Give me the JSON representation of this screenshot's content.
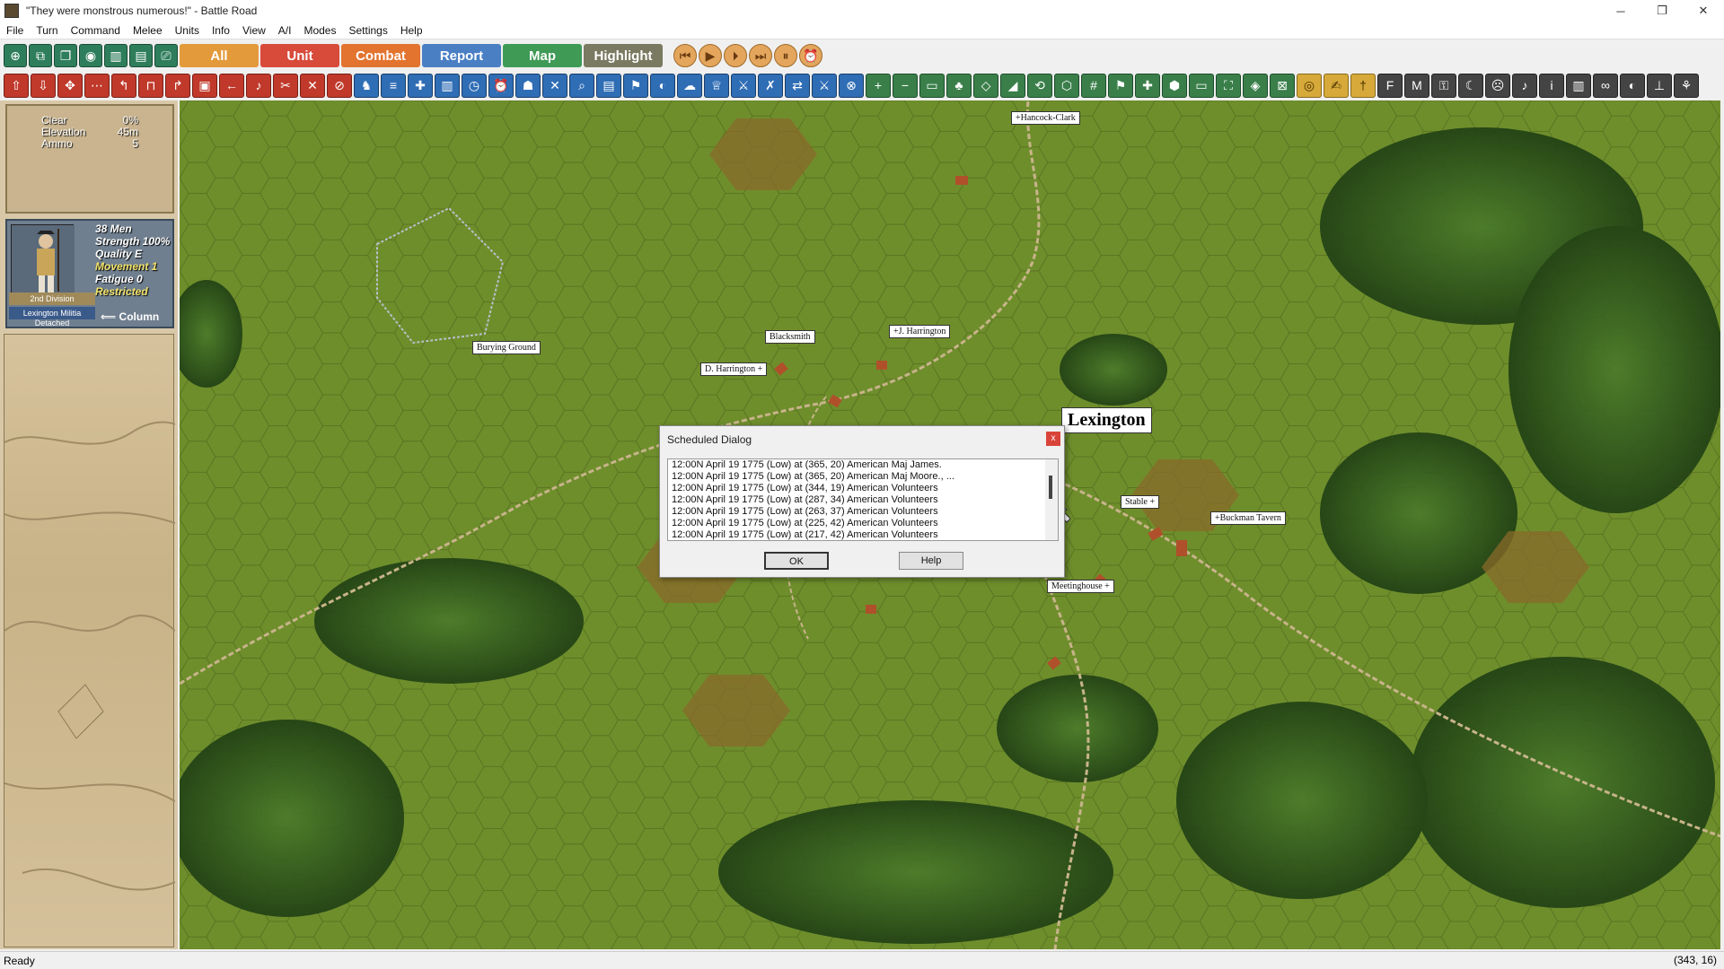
{
  "window": {
    "title": "\"They were monstrous numerous!\" - Battle Road"
  },
  "menu": [
    "File",
    "Turn",
    "Command",
    "Melee",
    "Units",
    "Info",
    "View",
    "A/I",
    "Modes",
    "Settings",
    "Help"
  ],
  "filters": [
    {
      "label": "All",
      "color": "#e39a3a"
    },
    {
      "label": "Unit",
      "color": "#d84a3a"
    },
    {
      "label": "Combat",
      "color": "#e2742f"
    },
    {
      "label": "Report",
      "color": "#4a7fc4"
    },
    {
      "label": "Map",
      "color": "#3f9a56"
    },
    {
      "label": "Highlight",
      "color": "#7a7a62"
    }
  ],
  "terrain": {
    "type_label": "Clear",
    "type_value": "0%",
    "elev_label": "Elevation",
    "elev_value": "45m",
    "ammo_label": "Ammo",
    "ammo_value": "5"
  },
  "unit": {
    "men": "38 Men",
    "strength": "Strength 100%",
    "quality": "Quality E",
    "movement": "Movement 1",
    "fatigue": "Fatigue 0",
    "restricted": "Restricted",
    "division": "2nd Division",
    "name": "Lexington Militia",
    "status": "Detached",
    "formation": "Column"
  },
  "map_labels": {
    "hancock": "Hancock-Clark",
    "blacksmith": "Blacksmith",
    "j_harrington": "J. Harrington",
    "d_harrington": "D. Harrington",
    "burying": "Burying Ground",
    "stable": "Stable",
    "buckman": "Buckman Tavern",
    "meetinghouse": "Meetinghouse",
    "town": "Lexington"
  },
  "dialog": {
    "title": "Scheduled Dialog",
    "close": "x",
    "entries": [
      "12:00N  April 19 1775 (Low) at (365, 20) American Maj James.",
      "12:00N  April 19 1775 (Low) at (365, 20) American Maj Moore., ...",
      "12:00N  April 19 1775 (Low) at (344, 19) American Volunteers",
      "12:00N  April 19 1775 (Low) at (287, 34) American Volunteers",
      "12:00N  April 19 1775 (Low) at (263, 37) American Volunteers",
      "12:00N  April 19 1775 (Low) at (225, 42) American Volunteers",
      "12:00N  April 19 1775 (Low) at (217, 42) American Volunteers"
    ],
    "ok": "OK",
    "help": "Help"
  },
  "status": {
    "text": "Ready",
    "coords": "(343, 16)"
  }
}
